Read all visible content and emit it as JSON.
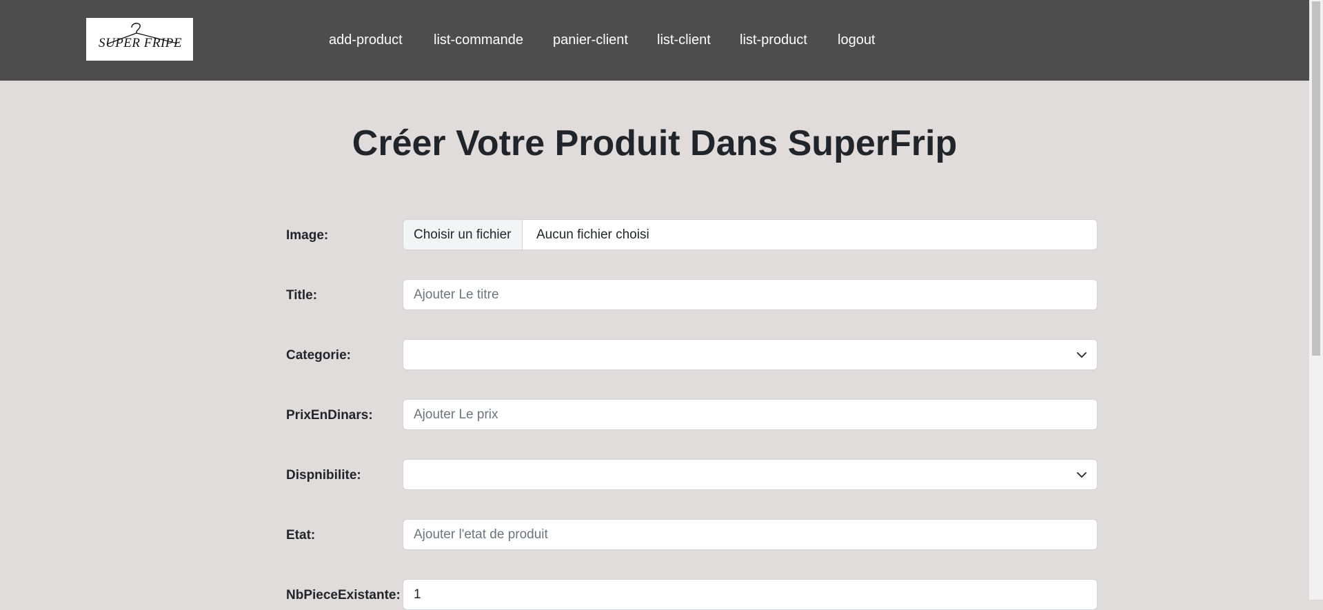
{
  "logo": {
    "text": "SUPER FRIPE"
  },
  "nav": [
    {
      "label": "add-product"
    },
    {
      "label": "list-commande"
    },
    {
      "label": "panier-client"
    },
    {
      "label": "list-client"
    },
    {
      "label": "list-product"
    },
    {
      "label": "logout"
    }
  ],
  "page": {
    "title": "Créer Votre Produit Dans SuperFrip"
  },
  "form": {
    "image": {
      "label": "Image:",
      "button": "Choisir un fichier",
      "status": "Aucun fichier choisi"
    },
    "title": {
      "label": "Title:",
      "value": "",
      "placeholder": "Ajouter Le titre"
    },
    "categorie": {
      "label": "Categorie:",
      "value": ""
    },
    "prix": {
      "label": "PrixEnDinars:",
      "value": "",
      "placeholder": "Ajouter Le prix"
    },
    "disponibilite": {
      "label": "Dispnibilite:",
      "value": ""
    },
    "etat": {
      "label": "Etat:",
      "value": "",
      "placeholder": "Ajouter l'etat de produit"
    },
    "nbpiece": {
      "label": "NbPieceExistante:",
      "value": "1"
    }
  },
  "colors": {
    "navbar": "#4d4d4d",
    "background": "#e1dcdc",
    "nav_text": "#ffffff"
  }
}
